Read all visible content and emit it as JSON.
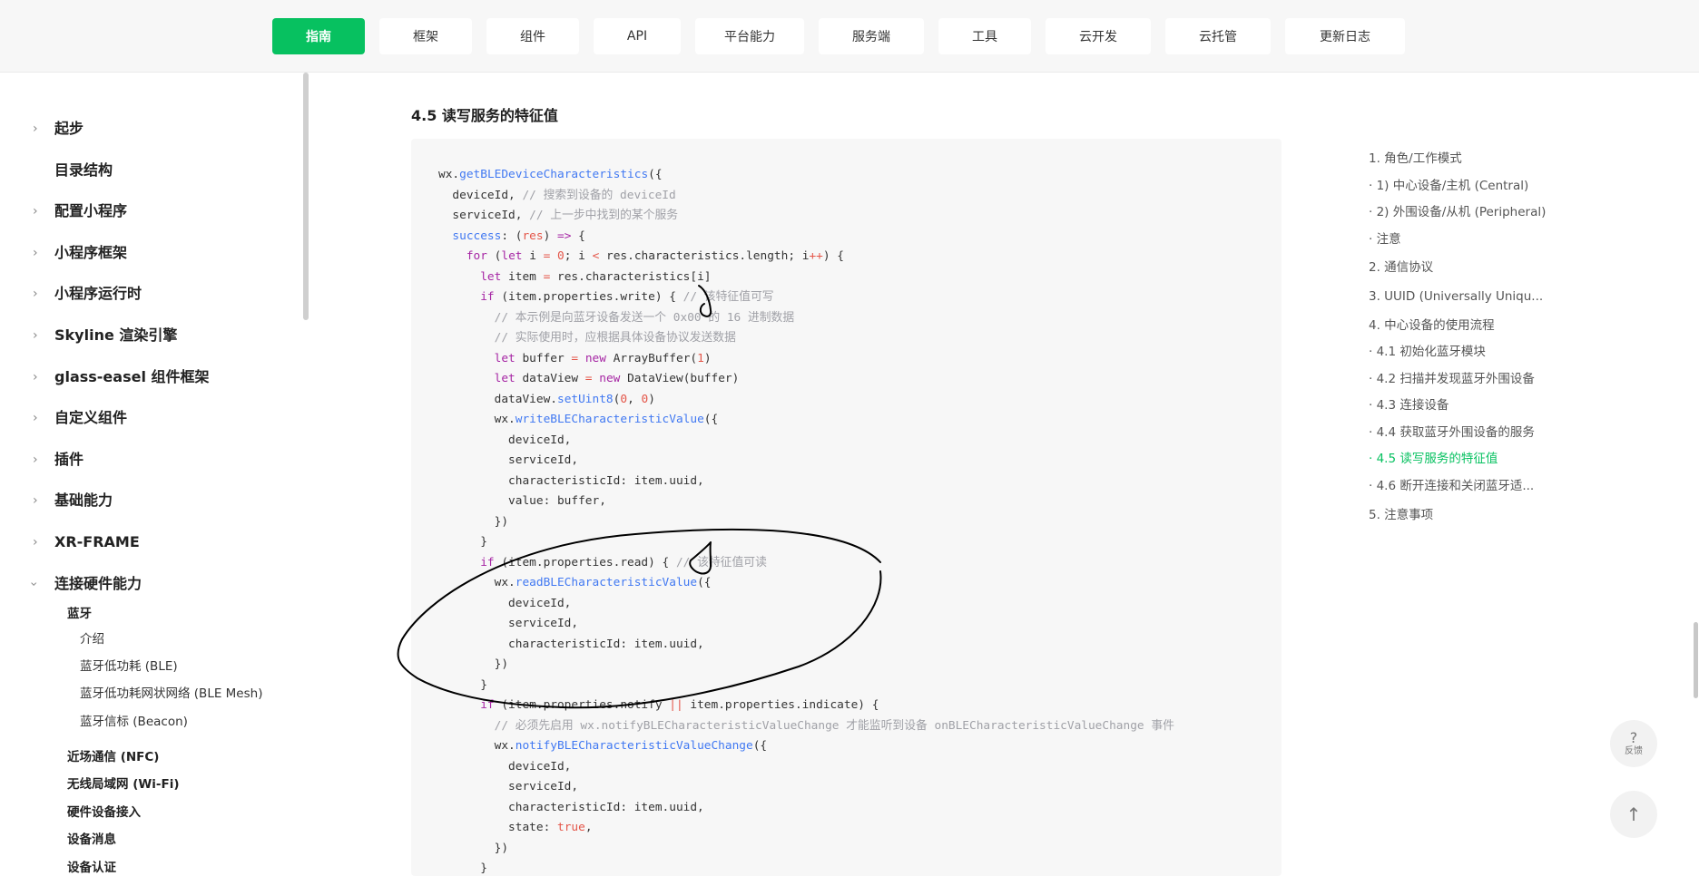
{
  "nav": {
    "tabs": [
      {
        "label": "指南",
        "active": true
      },
      {
        "label": "框架"
      },
      {
        "label": "组件"
      },
      {
        "label": "API"
      },
      {
        "label": "平台能力"
      },
      {
        "label": "服务端"
      },
      {
        "label": "工具"
      },
      {
        "label": "云开发"
      },
      {
        "label": "云托管"
      },
      {
        "label": "更新日志"
      }
    ]
  },
  "sidebar": {
    "items": [
      {
        "label": "起步",
        "expandable": true
      },
      {
        "label": "目录结构",
        "expandable": false
      },
      {
        "label": "配置小程序",
        "expandable": true
      },
      {
        "label": "小程序框架",
        "expandable": true
      },
      {
        "label": "小程序运行时",
        "expandable": true
      },
      {
        "label": "Skyline 渲染引擎",
        "expandable": true
      },
      {
        "label": "glass-easel 组件框架",
        "expandable": true
      },
      {
        "label": "自定义组件",
        "expandable": true
      },
      {
        "label": "插件",
        "expandable": true
      },
      {
        "label": "基础能力",
        "expandable": true
      },
      {
        "label": "XR-FRAME",
        "expandable": true
      },
      {
        "label": "连接硬件能力",
        "expandable": true,
        "expanded": true
      }
    ],
    "bluetooth": {
      "label": "蓝牙",
      "children": [
        "介绍",
        "蓝牙低功耗 (BLE)",
        "蓝牙低功耗网状网络 (BLE Mesh)",
        "蓝牙信标 (Beacon)"
      ]
    },
    "subsections": [
      "近场通信 (NFC)",
      "无线局域网 (Wi-Fi)",
      "硬件设备接入",
      "设备消息",
      "设备认证"
    ]
  },
  "main": {
    "heading": "4.5 读写服务的特征值"
  },
  "toc": {
    "items": [
      {
        "label": "1. 角色/工作模式"
      },
      {
        "label": "· 1) 中心设备/主机 (Central)"
      },
      {
        "label": "· 2) 外围设备/从机 (Peripheral)"
      },
      {
        "label": "· 注意"
      },
      {
        "label": "2. 通信协议"
      },
      {
        "label": "3. UUID (Universally Uniqu..."
      },
      {
        "label": "4. 中心设备的使用流程"
      },
      {
        "label": "· 4.1 初始化蓝牙模块"
      },
      {
        "label": "· 4.2 扫描并发现蓝牙外围设备"
      },
      {
        "label": "· 4.3 连接设备"
      },
      {
        "label": "· 4.4 获取蓝牙外围设备的服务"
      },
      {
        "label": "· 4.5 读写服务的特征值",
        "active": true
      },
      {
        "label": "· 4.6 断开连接和关闭蓝牙适..."
      },
      {
        "label": "5. 注意事项"
      }
    ]
  },
  "floating": {
    "feedback_icon": "?",
    "feedback_label": "反馈",
    "top_icon": "↑"
  },
  "colors": {
    "accent": "#07c160",
    "annotation_stroke": "#000000"
  },
  "code": {
    "lines": [
      [
        [
          "p",
          "wx."
        ],
        [
          "f",
          "getBLEDeviceCharacteristics"
        ],
        [
          "p",
          "({"
        ]
      ],
      [
        [
          "p",
          "  deviceId, "
        ],
        [
          "c",
          "// 搜索到设备的 deviceId"
        ]
      ],
      [
        [
          "p",
          "  serviceId, "
        ],
        [
          "c",
          "// 上一步中找到的某个服务"
        ]
      ],
      [
        [
          "f",
          "  success"
        ],
        [
          "p",
          ": ("
        ],
        [
          "n",
          "res"
        ],
        [
          "p",
          ") "
        ],
        [
          "k",
          "=>"
        ],
        [
          "p",
          " {"
        ]
      ],
      [
        [
          "k",
          "    for"
        ],
        [
          "p",
          " ("
        ],
        [
          "k",
          "let"
        ],
        [
          "p",
          " i "
        ],
        [
          "o",
          "="
        ],
        [
          "p",
          " "
        ],
        [
          "n",
          "0"
        ],
        [
          "p",
          "; i "
        ],
        [
          "o",
          "<"
        ],
        [
          "p",
          " res.characteristics.length; i"
        ],
        [
          "o",
          "++"
        ],
        [
          "p",
          ") {"
        ]
      ],
      [
        [
          "k",
          "      let"
        ],
        [
          "p",
          " item "
        ],
        [
          "o",
          "="
        ],
        [
          "p",
          " res.characteristics[i]"
        ]
      ],
      [
        [
          "k",
          "      if"
        ],
        [
          "p",
          " (item.properties.write) { "
        ],
        [
          "c",
          "// 该特征值可写"
        ]
      ],
      [
        [
          "c",
          "        // 本示例是向蓝牙设备发送一个 0x00 的 16 进制数据"
        ]
      ],
      [
        [
          "c",
          "        // 实际使用时，应根据具体设备协议发送数据"
        ]
      ],
      [
        [
          "k",
          "        let"
        ],
        [
          "p",
          " buffer "
        ],
        [
          "o",
          "="
        ],
        [
          "p",
          " "
        ],
        [
          "k",
          "new"
        ],
        [
          "p",
          " ArrayBuffer("
        ],
        [
          "n",
          "1"
        ],
        [
          "p",
          ")"
        ]
      ],
      [
        [
          "k",
          "        let"
        ],
        [
          "p",
          " dataView "
        ],
        [
          "o",
          "="
        ],
        [
          "p",
          " "
        ],
        [
          "k",
          "new"
        ],
        [
          "p",
          " DataView(buffer)"
        ]
      ],
      [
        [
          "p",
          "        dataView."
        ],
        [
          "f",
          "setUint8"
        ],
        [
          "p",
          "("
        ],
        [
          "n",
          "0"
        ],
        [
          "p",
          ", "
        ],
        [
          "n",
          "0"
        ],
        [
          "p",
          ")"
        ]
      ],
      [
        [
          "p",
          "        wx."
        ],
        [
          "f",
          "writeBLECharacteristicValue"
        ],
        [
          "p",
          "({"
        ]
      ],
      [
        [
          "p",
          "          deviceId,"
        ]
      ],
      [
        [
          "p",
          "          serviceId,"
        ]
      ],
      [
        [
          "p",
          "          characteristicId: item.uuid,"
        ]
      ],
      [
        [
          "p",
          "          value: buffer,"
        ]
      ],
      [
        [
          "p",
          "        })"
        ]
      ],
      [
        [
          "p",
          "      }"
        ]
      ],
      [
        [
          "k",
          "      if"
        ],
        [
          "p",
          " (item.properties.read) { "
        ],
        [
          "c",
          "// 该特征值可读"
        ]
      ],
      [
        [
          "p",
          "        wx."
        ],
        [
          "f",
          "readBLECharacteristicValue"
        ],
        [
          "p",
          "({"
        ]
      ],
      [
        [
          "p",
          "          deviceId,"
        ]
      ],
      [
        [
          "p",
          "          serviceId,"
        ]
      ],
      [
        [
          "p",
          "          characteristicId: item.uuid,"
        ]
      ],
      [
        [
          "p",
          "        })"
        ]
      ],
      [
        [
          "p",
          "      }"
        ]
      ],
      [
        [
          "k",
          "      if"
        ],
        [
          "p",
          " (item.properties.notify "
        ],
        [
          "o",
          "||"
        ],
        [
          "p",
          " item.properties.indicate) {"
        ]
      ],
      [
        [
          "c",
          "        // 必须先启用 wx.notifyBLECharacteristicValueChange 才能监听到设备 onBLECharacteristicValueChange 事件"
        ]
      ],
      [
        [
          "p",
          "        wx."
        ],
        [
          "f",
          "notifyBLECharacteristicValueChange"
        ],
        [
          "p",
          "({"
        ]
      ],
      [
        [
          "p",
          "          deviceId,"
        ]
      ],
      [
        [
          "p",
          "          serviceId,"
        ]
      ],
      [
        [
          "p",
          "          characteristicId: item.uuid,"
        ]
      ],
      [
        [
          "p",
          "          state: "
        ],
        [
          "n",
          "true"
        ],
        [
          "p",
          ","
        ]
      ],
      [
        [
          "p",
          "        })"
        ]
      ],
      [
        [
          "p",
          "      }"
        ]
      ]
    ]
  }
}
